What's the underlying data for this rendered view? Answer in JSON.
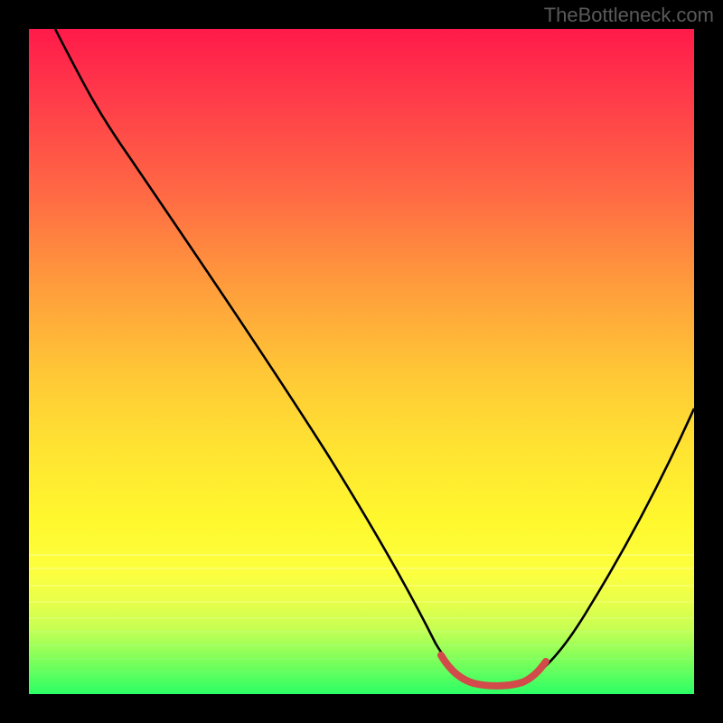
{
  "watermark": "TheBottleneck.com",
  "chart_data": {
    "type": "line",
    "title": "",
    "xlabel": "",
    "ylabel": "",
    "xlim": [
      0,
      100
    ],
    "ylim": [
      0,
      100
    ],
    "series": [
      {
        "name": "black-curve",
        "color": "#000000",
        "x": [
          4,
          12,
          22,
          32,
          42,
          52,
          58,
          62,
          66,
          70,
          74,
          80,
          86,
          92,
          100
        ],
        "values": [
          100,
          88,
          74,
          60,
          46,
          32,
          20,
          12,
          5,
          2,
          2,
          6,
          16,
          28,
          48
        ]
      },
      {
        "name": "red-minimum-highlight",
        "color": "#d24a4a",
        "x": [
          62,
          64,
          66,
          68,
          70,
          72,
          74,
          76
        ],
        "values": [
          4,
          2.5,
          2,
          1.8,
          1.8,
          2,
          2.5,
          4
        ]
      }
    ],
    "gradient_stops": [
      {
        "pos": 0,
        "color": "#ff1a4a"
      },
      {
        "pos": 10,
        "color": "#ff3a4a"
      },
      {
        "pos": 25,
        "color": "#ff6a44"
      },
      {
        "pos": 38,
        "color": "#ff9a3c"
      },
      {
        "pos": 52,
        "color": "#ffc836"
      },
      {
        "pos": 63,
        "color": "#ffe332"
      },
      {
        "pos": 74,
        "color": "#fff82e"
      },
      {
        "pos": 82,
        "color": "#fcff40"
      },
      {
        "pos": 86,
        "color": "#e8ff4a"
      },
      {
        "pos": 90,
        "color": "#c8ff52"
      },
      {
        "pos": 93,
        "color": "#9cff58"
      },
      {
        "pos": 96,
        "color": "#6cff5c"
      },
      {
        "pos": 100,
        "color": "#2cff66"
      }
    ]
  }
}
